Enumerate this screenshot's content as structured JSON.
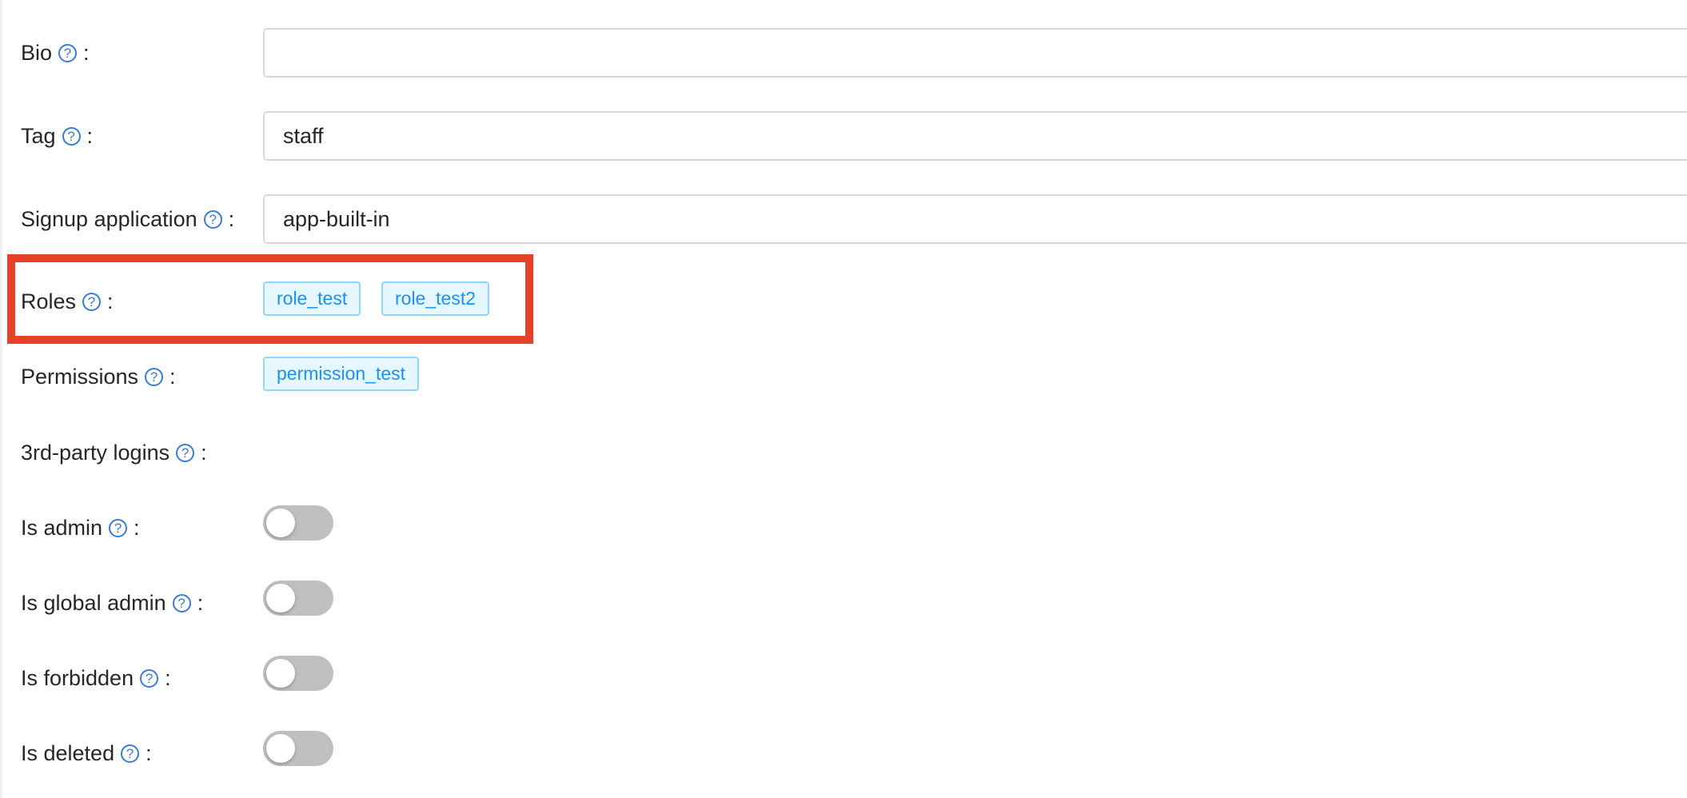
{
  "form": {
    "bio": {
      "label": "Bio",
      "value": ""
    },
    "tag": {
      "label": "Tag",
      "value": "staff"
    },
    "signup_application": {
      "label": "Signup application",
      "value": "app-built-in"
    },
    "roles": {
      "label": "Roles",
      "items": [
        "role_test",
        "role_test2"
      ]
    },
    "permissions": {
      "label": "Permissions",
      "items": [
        "permission_test"
      ]
    },
    "third_party_logins": {
      "label": "3rd-party logins"
    },
    "is_admin": {
      "label": "Is admin",
      "checked": false
    },
    "is_global_admin": {
      "label": "Is global admin",
      "checked": false
    },
    "is_forbidden": {
      "label": "Is forbidden",
      "checked": false
    },
    "is_deleted": {
      "label": "Is deleted",
      "checked": false
    }
  },
  "help_glyph": "?",
  "colon": ":",
  "colors": {
    "highlight": "#e8412a",
    "tag_text": "#1890ff",
    "help_icon": "#3a7bd5",
    "switch_off": "#bfbfbf"
  }
}
